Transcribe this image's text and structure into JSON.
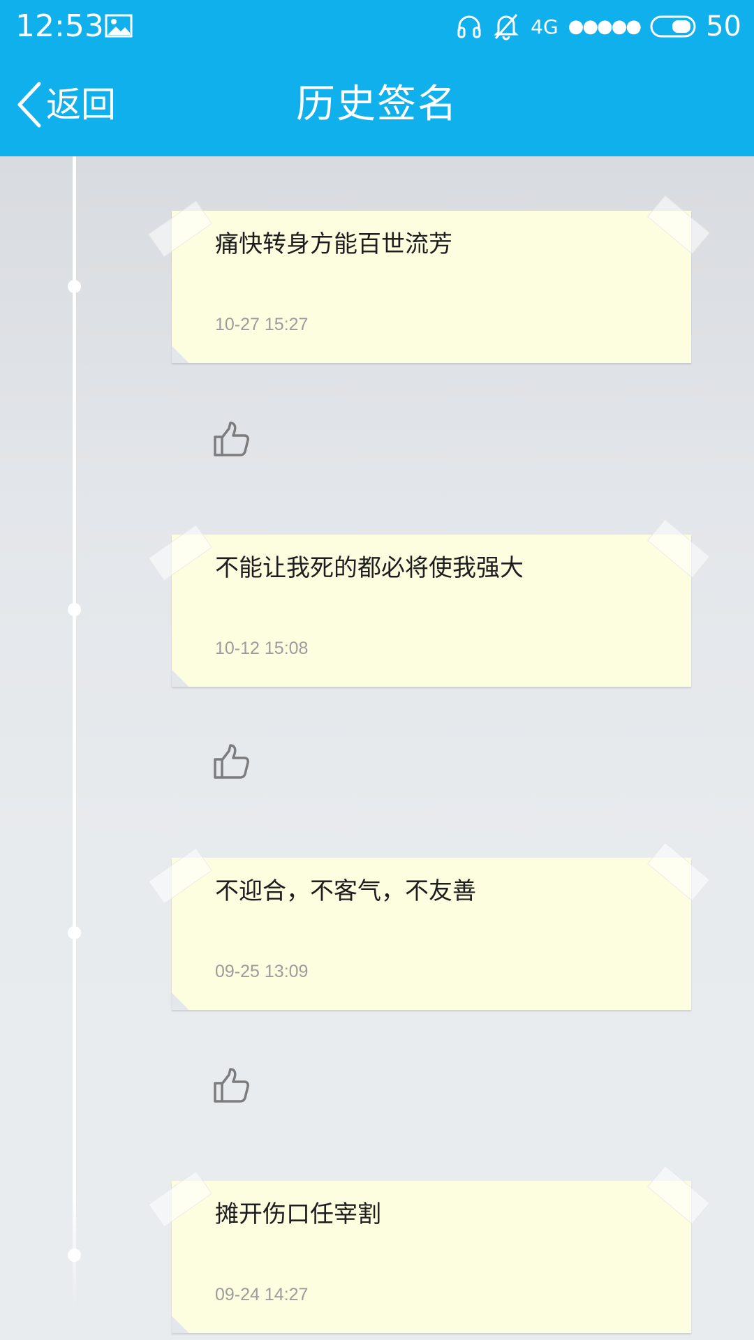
{
  "status_bar": {
    "time": "12:53",
    "network": "4G",
    "signal": "●●●●●",
    "battery": "50"
  },
  "header": {
    "back_label": "返回",
    "title": "历史签名",
    "accent_color": "#10b0ec"
  },
  "signatures": [
    {
      "text": "痛快转身方能百世流芳",
      "time": "10-27 15:27",
      "like_icon": "thumbs-up-icon"
    },
    {
      "text": "不能让我死的都必将使我强大",
      "time": "10-12 15:08",
      "like_icon": "thumbs-up-icon"
    },
    {
      "text": "不迎合，不客气，不友善",
      "time": "09-25 13:09",
      "like_icon": "thumbs-up-icon"
    },
    {
      "text": "摊开伤口任宰割",
      "time": "09-24 14:27",
      "like_icon": "thumbs-up-icon"
    }
  ]
}
